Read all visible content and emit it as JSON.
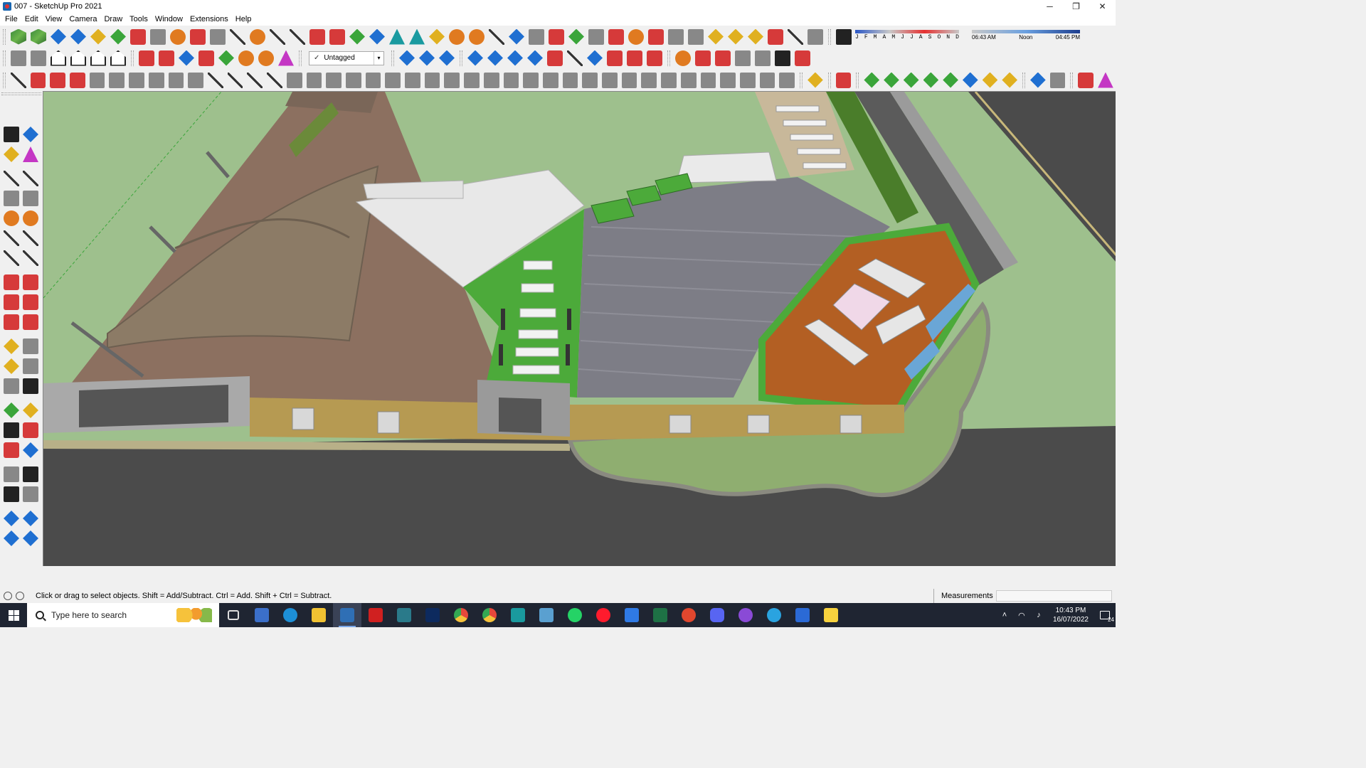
{
  "window": {
    "title": "007 - SketchUp Pro 2021",
    "minimize": "─",
    "restore": "❐",
    "close": "✕"
  },
  "menu": [
    "File",
    "Edit",
    "View",
    "Camera",
    "Draw",
    "Tools",
    "Window",
    "Extensions",
    "Help"
  ],
  "tag_selector": {
    "check": "✓",
    "value": "Untagged",
    "arrow": "▾"
  },
  "shadow": {
    "months": [
      "J",
      "F",
      "M",
      "A",
      "M",
      "J",
      "J",
      "A",
      "S",
      "O",
      "N",
      "D"
    ],
    "time_start": "06:43 AM",
    "time_mid": "Noon",
    "time_end": "04:45 PM"
  },
  "status": {
    "hint": "Click or drag to select objects. Shift = Add/Subtract. Ctrl = Add. Shift + Ctrl = Subtract.",
    "measurements_label": "Measurements",
    "measurements_value": ""
  },
  "taskbar": {
    "search_placeholder": "Type here to search",
    "time": "10:43 PM",
    "date": "16/07/2022",
    "notifications": "24",
    "apps": [
      {
        "name": "task-view",
        "color": "#1f2532"
      },
      {
        "name": "calculator",
        "color": "#3b6fc9"
      },
      {
        "name": "edge",
        "color": "#1d8fd6"
      },
      {
        "name": "file-explorer",
        "color": "#f1c232"
      },
      {
        "name": "sketchup",
        "color": "#2f6fb5"
      },
      {
        "name": "acrobat",
        "color": "#d02020"
      },
      {
        "name": "autocad",
        "color": "#2a7a8a"
      },
      {
        "name": "photoshop",
        "color": "#0d2a5e"
      },
      {
        "name": "chrome",
        "color": "#e7483b"
      },
      {
        "name": "chrome-2",
        "color": "#34a853"
      },
      {
        "name": "layout",
        "color": "#1a9a9e"
      },
      {
        "name": "style-builder",
        "color": "#5aa0d0"
      },
      {
        "name": "whatsapp",
        "color": "#25d366"
      },
      {
        "name": "opera",
        "color": "#ff1b2d"
      },
      {
        "name": "tasks",
        "color": "#2f7ae5"
      },
      {
        "name": "excel",
        "color": "#1e7145"
      },
      {
        "name": "grammarly",
        "color": "#e0472e"
      },
      {
        "name": "discord",
        "color": "#5865f2"
      },
      {
        "name": "podcasts",
        "color": "#8a4ad6"
      },
      {
        "name": "telegram",
        "color": "#2aa3e0"
      },
      {
        "name": "app-blue",
        "color": "#2b6ad6"
      },
      {
        "name": "sticky-notes",
        "color": "#f7d23e"
      }
    ]
  },
  "tray": {
    "chevron": "˄",
    "wifi": "◠",
    "volume": "♪"
  }
}
